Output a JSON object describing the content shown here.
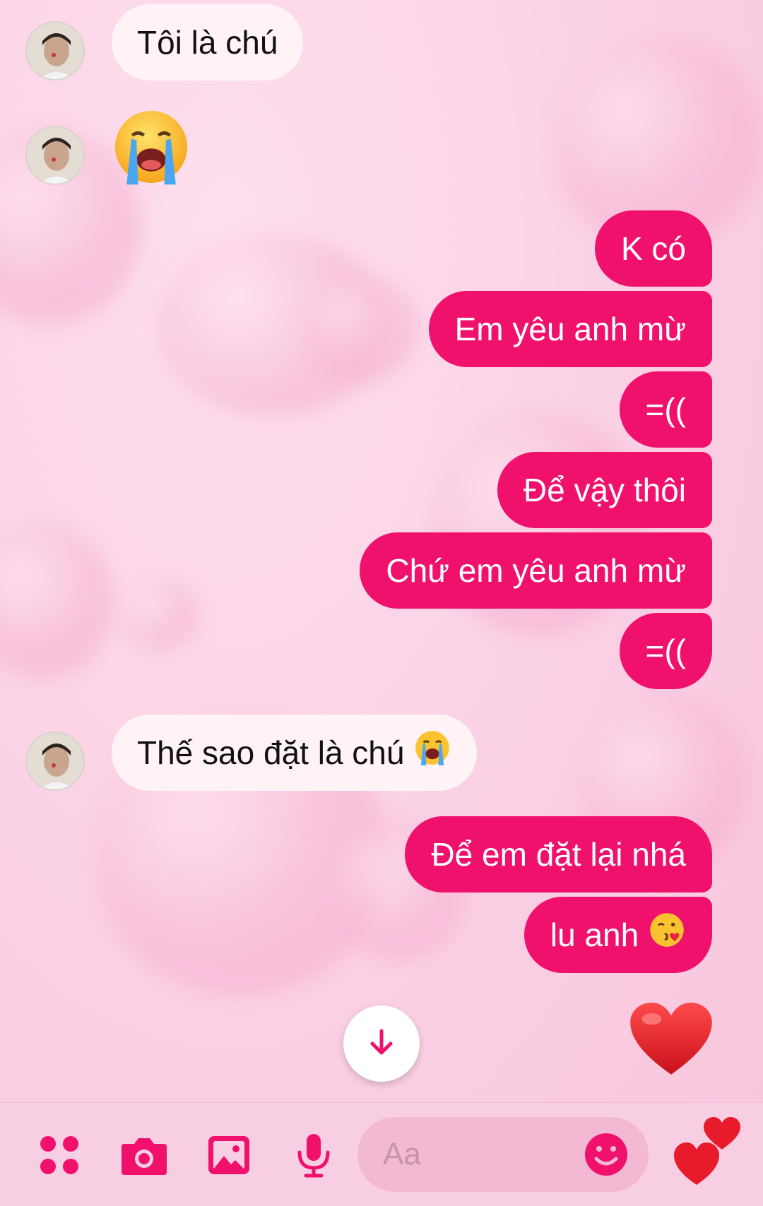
{
  "colors": {
    "accent": "#f0116d",
    "incoming_bubble": "#fff3f6",
    "background": "#fbd3e6"
  },
  "messages": [
    {
      "side": "in",
      "text": "Tôi là chú",
      "avatar": true
    },
    {
      "side": "in",
      "emoji": "loudly-crying-face",
      "avatar": true
    },
    {
      "side": "out",
      "text": "K có"
    },
    {
      "side": "out",
      "text": "Em yêu anh mừ"
    },
    {
      "side": "out",
      "text": "=(("
    },
    {
      "side": "out",
      "text": "Để vậy thôi"
    },
    {
      "side": "out",
      "text": "Chứ em yêu anh mừ"
    },
    {
      "side": "out",
      "text": "=(("
    },
    {
      "side": "in",
      "text": "Thế sao đặt là chú",
      "emoji": "loudly-crying-face",
      "avatar": true
    },
    {
      "side": "out",
      "text": "Để em đặt lại nhá"
    },
    {
      "side": "out",
      "text": "lu anh",
      "emoji": "face-blowing-a-kiss"
    },
    {
      "side": "out",
      "emoji": "red-heart"
    }
  ],
  "composer": {
    "placeholder": "Aa",
    "icons": [
      "menu-dots-icon",
      "camera-icon",
      "image-icon",
      "microphone-icon",
      "emoji-icon",
      "hearts-send-icon"
    ]
  },
  "scroll_button_icon": "arrow-down-icon"
}
